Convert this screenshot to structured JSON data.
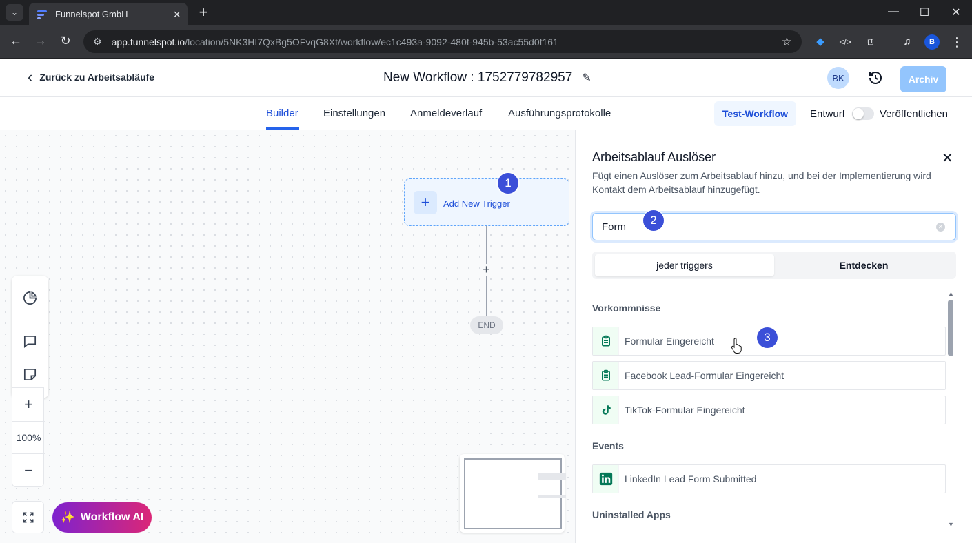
{
  "browser": {
    "tab_title": "Funnelspot GmbH",
    "url_host": "app.funnelspot.io",
    "url_path": "/location/5NK3HI7QxBg5OFvqG8Xt/workflow/ec1c493a-9092-480f-945b-53ac55d0f161",
    "profile_initial": "B"
  },
  "header": {
    "back_label": "Zurück zu Arbeitsabläufe",
    "workflow_title": "New Workflow : 1752779782957",
    "avatar_initials": "BK",
    "archive_label": "Archiv"
  },
  "subnav": {
    "tabs": [
      {
        "label": "Builder",
        "active": true
      },
      {
        "label": "Einstellungen",
        "active": false
      },
      {
        "label": "Anmeldeverlauf",
        "active": false
      },
      {
        "label": "Ausführungsprotokolle",
        "active": false
      }
    ],
    "test_workflow_label": "Test-Workflow",
    "draft_label": "Entwurf",
    "publish_label": "Veröffentlichen",
    "published": false
  },
  "canvas": {
    "trigger_label": "Add New Trigger",
    "end_label": "END",
    "zoom": "100%",
    "ai_button_label": "Workflow AI"
  },
  "badges": [
    "1",
    "2",
    "3"
  ],
  "panel": {
    "title": "Arbeitsablauf Auslöser",
    "description": "Fügt einen Auslöser zum Arbeitsablauf hinzu, und bei der Implementierung wird Kontakt dem Arbeitsablauf hinzugefügt.",
    "search_value": "Form",
    "segments": [
      "jeder triggers",
      "Entdecken"
    ],
    "sections": [
      {
        "heading": "Vorkommnisse",
        "items": [
          {
            "label": "Formular Eingereicht",
            "icon": "clipboard-icon"
          },
          {
            "label": "Facebook Lead-Formular Eingereicht",
            "icon": "clipboard-icon"
          },
          {
            "label": "TikTok-Formular Eingereicht",
            "icon": "tiktok-icon"
          }
        ]
      },
      {
        "heading": "Events",
        "items": [
          {
            "label": "LinkedIn Lead Form Submitted",
            "icon": "linkedin-icon"
          }
        ]
      },
      {
        "heading": "Uninstalled Apps",
        "items": []
      }
    ]
  },
  "colors": {
    "primary": "#2563eb",
    "badge": "#3b4fd8",
    "icon_green": "#047857"
  }
}
